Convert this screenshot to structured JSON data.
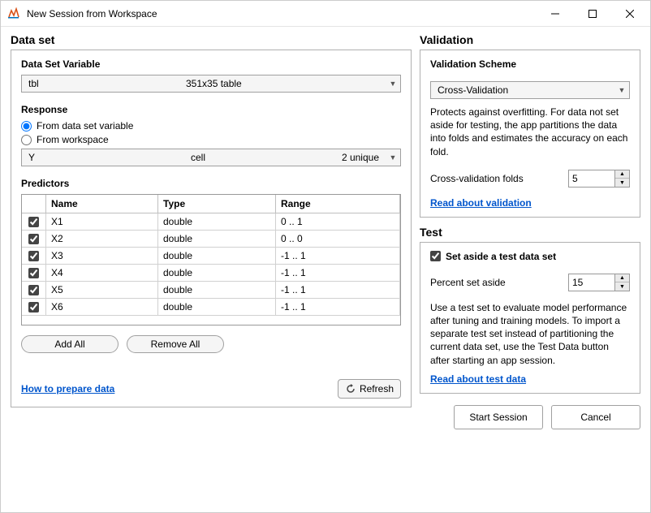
{
  "window": {
    "title": "New Session from Workspace"
  },
  "data_set": {
    "section_title": "Data set",
    "variable_label": "Data Set Variable",
    "variable_name": "tbl",
    "variable_dims": "351x35 table",
    "response_label": "Response",
    "response_from_ds": "From data set variable",
    "response_from_ws": "From workspace",
    "response_var": "Y",
    "response_type": "cell",
    "response_info": "2 unique",
    "predictors_label": "Predictors",
    "headers": {
      "name": "Name",
      "type": "Type",
      "range": "Range"
    },
    "predictors": [
      {
        "name": "X1",
        "type": "double",
        "range": "0 .. 1"
      },
      {
        "name": "X2",
        "type": "double",
        "range": "0 .. 0"
      },
      {
        "name": "X3",
        "type": "double",
        "range": "-1 .. 1"
      },
      {
        "name": "X4",
        "type": "double",
        "range": "-1 .. 1"
      },
      {
        "name": "X5",
        "type": "double",
        "range": "-1 .. 1"
      },
      {
        "name": "X6",
        "type": "double",
        "range": "-1 .. 1"
      }
    ],
    "add_all": "Add All",
    "remove_all": "Remove All",
    "prepare_link": "How to prepare data",
    "refresh": "Refresh"
  },
  "validation": {
    "section_title": "Validation",
    "scheme_label": "Validation Scheme",
    "scheme_value": "Cross-Validation",
    "description": "Protects against overfitting. For data not set aside for testing, the app partitions the data into folds and estimates the accuracy on each fold.",
    "folds_label": "Cross-validation folds",
    "folds_value": "5",
    "link": "Read about validation"
  },
  "test": {
    "section_title": "Test",
    "set_aside_label": "Set aside a test data set",
    "percent_label": "Percent set aside",
    "percent_value": "15",
    "description": "Use a test set to evaluate model performance after tuning and training models. To import a separate test set instead of partitioning the current data set, use the Test Data button after starting an app session.",
    "link": "Read about test data"
  },
  "footer": {
    "start": "Start Session",
    "cancel": "Cancel"
  }
}
